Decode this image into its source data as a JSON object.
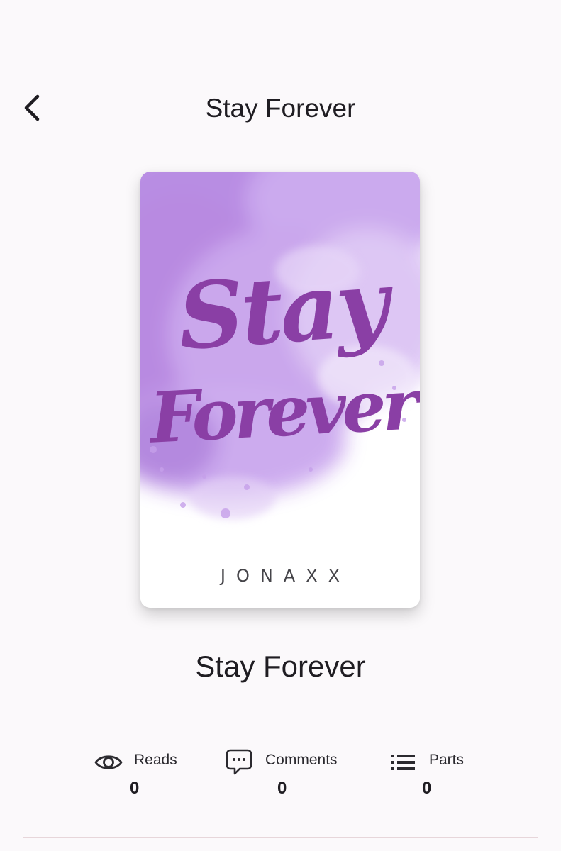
{
  "header": {
    "title": "Stay Forever",
    "back_icon": "chevron-left-icon"
  },
  "cover": {
    "title_lines": [
      "Stay",
      "Forever"
    ],
    "author": "JONAXX",
    "colors": {
      "watercolor": "#b27ee0",
      "lettering": "#8a3fa5",
      "background": "#ffffff"
    }
  },
  "story": {
    "title": "Stay Forever"
  },
  "stats": [
    {
      "icon": "eye-icon",
      "label": "Reads",
      "value": "0"
    },
    {
      "icon": "comment-icon",
      "label": "Comments",
      "value": "0"
    },
    {
      "icon": "list-icon",
      "label": "Parts",
      "value": "0"
    }
  ]
}
